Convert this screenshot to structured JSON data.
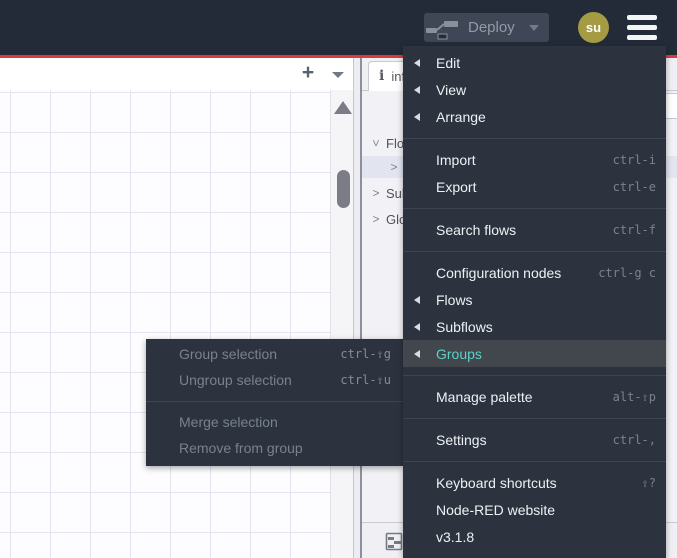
{
  "colors": {
    "accent_red": "#dc3b3b",
    "header_bg": "#232b39",
    "menu_bg": "#2c333f",
    "menu_highlight_text": "#5cd2c8",
    "avatar_bg": "#a49b42",
    "tree_selected_bg": "#e2e5f0"
  },
  "icons": {
    "chevron": ">"
  },
  "header": {
    "deploy_label": "Deploy",
    "user_badge": "su"
  },
  "workspace_tabbar": {
    "add_button": "+"
  },
  "sidebar": {
    "active_tab": {
      "icon_glyph": "i",
      "label": "info"
    },
    "tree": {
      "items": [
        {
          "label": "Flows"
        },
        {
          "label": ""
        },
        {
          "label": "Subflows"
        },
        {
          "label": "Global"
        }
      ]
    }
  },
  "menu": {
    "items": [
      {
        "label": "Edit"
      },
      {
        "label": "View"
      },
      {
        "label": "Arrange"
      },
      {
        "label": "Import",
        "shortcut": "ctrl-i"
      },
      {
        "label": "Export",
        "shortcut": "ctrl-e"
      },
      {
        "label": "Search flows",
        "shortcut": "ctrl-f"
      },
      {
        "label": "Configuration nodes",
        "shortcut": "ctrl-g c"
      },
      {
        "label": "Flows"
      },
      {
        "label": "Subflows"
      },
      {
        "label": "Groups"
      },
      {
        "label": "Manage palette",
        "shortcut": "alt-⇧p"
      },
      {
        "label": "Settings",
        "shortcut": "ctrl-,"
      },
      {
        "label": "Keyboard shortcuts",
        "shortcut": "⇧?"
      },
      {
        "label": "Node-RED website"
      },
      {
        "label": "v3.1.8"
      }
    ]
  },
  "submenu": {
    "items": [
      {
        "label": "Group selection",
        "shortcut": "ctrl-⇧g"
      },
      {
        "label": "Ungroup selection",
        "shortcut": "ctrl-⇧u"
      },
      {
        "label": "Merge selection"
      },
      {
        "label": "Remove from group"
      }
    ]
  }
}
